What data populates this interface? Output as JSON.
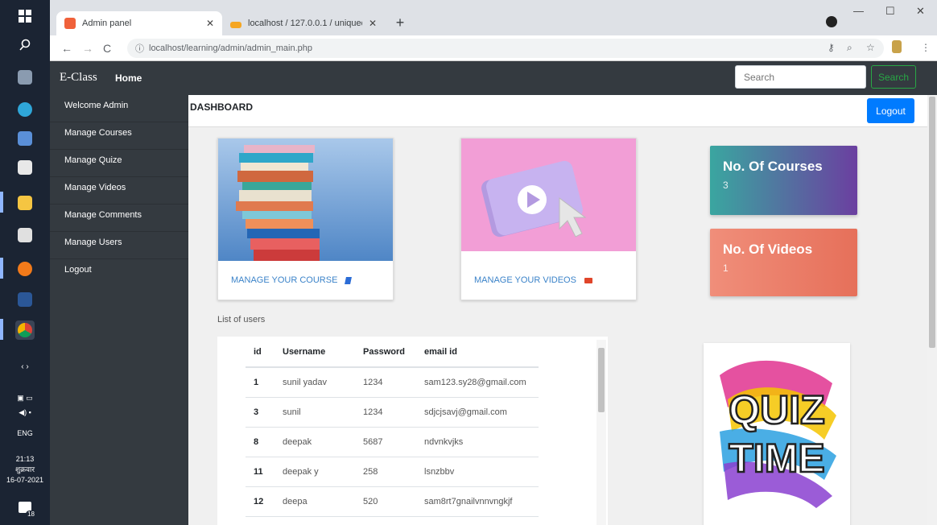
{
  "taskbar": {
    "time": "21:13",
    "day": "शुक्रवार",
    "date": "16-07-2021",
    "lang": "ENG",
    "notifications": "18"
  },
  "browser": {
    "tabs": [
      {
        "label": "Admin panel",
        "icon": "tab-favicon-icon"
      },
      {
        "label": "localhost / 127.0.0.1 / uniquede...",
        "icon": "phpmyadmin-icon"
      }
    ],
    "url": "localhost/learning/admin/admin_main.php"
  },
  "nav": {
    "brand": "E-Class",
    "home": "Home",
    "search_placeholder": "Search",
    "search_button": "Search"
  },
  "sidebar": {
    "items": [
      {
        "label": "Welcome Admin"
      },
      {
        "label": "Manage Courses"
      },
      {
        "label": "Manage Quize"
      },
      {
        "label": "Manage Videos"
      },
      {
        "label": "Manage Comments"
      },
      {
        "label": "Manage Users"
      },
      {
        "label": "Logout"
      }
    ]
  },
  "dashboard": {
    "title": "DASHBOARD",
    "logout": "Logout",
    "course_card": {
      "link": "MANAGE YOUR COURSE"
    },
    "video_card": {
      "link": "MANAGE YOUR VIDEOS"
    },
    "stats": [
      {
        "title": "No. Of Courses",
        "value": "3"
      },
      {
        "title": "No. Of Videos",
        "value": "1"
      }
    ],
    "list_label": "List of users",
    "table": {
      "headers": [
        "id",
        "Username",
        "Password",
        "email id"
      ],
      "rows": [
        [
          "1",
          "sunil yadav",
          "1234",
          "sam123.sy28@gmail.com"
        ],
        [
          "3",
          "sunil",
          "1234",
          "sdjcjsavj@gmail.com"
        ],
        [
          "8",
          "deepak",
          "5687",
          "ndvnkvjks"
        ],
        [
          "11",
          "deepak y",
          "258",
          "lsnzbbv"
        ],
        [
          "12",
          "deepa",
          "520",
          "sam8rt7gnailvnnvngkjf"
        ]
      ]
    },
    "quiz_image": {
      "line1": "QUIZ",
      "line2": "TIME"
    }
  },
  "colors": {
    "navbar": "#343a40",
    "primary": "#007bff",
    "success": "#28a745",
    "courses_gradient": [
      "#3aa6a0",
      "#6b3fa0"
    ],
    "videos_gradient": [
      "#f08e7a",
      "#e7745f"
    ]
  }
}
